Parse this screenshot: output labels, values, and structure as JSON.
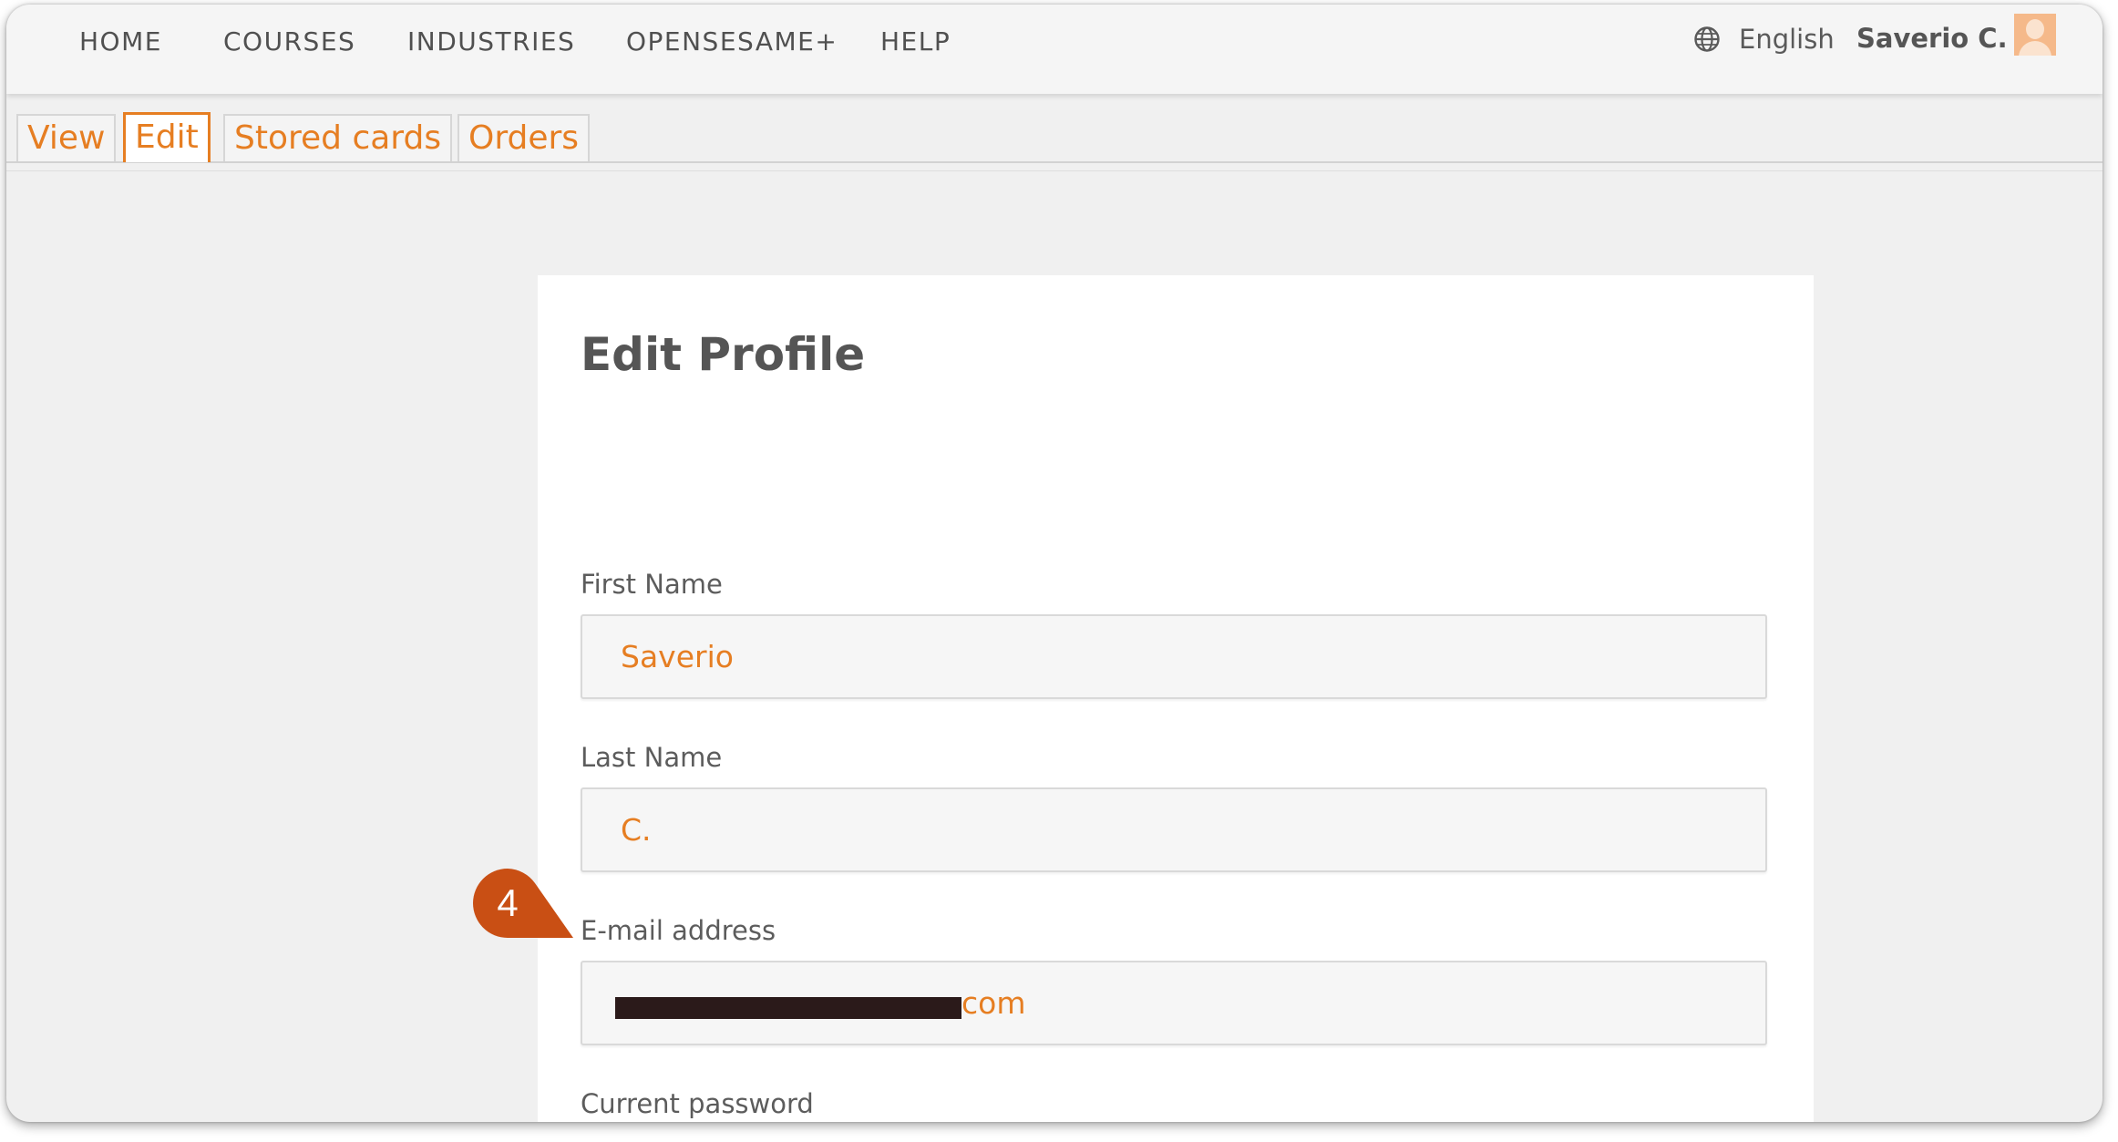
{
  "nav": {
    "items": [
      {
        "id": "home",
        "label": "HOME"
      },
      {
        "id": "courses",
        "label": "COURSES"
      },
      {
        "id": "industries",
        "label": "INDUSTRIES"
      },
      {
        "id": "opensesame-plus",
        "label": "OPENSESAME+"
      },
      {
        "id": "help",
        "label": "HELP"
      }
    ],
    "language": "English",
    "language_icon": "globe-icon",
    "user_name": "Saverio C.",
    "avatar_icon": "user-avatar"
  },
  "tabs": [
    {
      "label": "View",
      "active": false
    },
    {
      "label": "Edit",
      "active": true
    },
    {
      "label": "Stored cards",
      "active": false
    },
    {
      "label": "Orders",
      "active": false
    }
  ],
  "form": {
    "title": "Edit Profile",
    "first_name": {
      "label": "First Name",
      "value": "Saverio"
    },
    "last_name": {
      "label": "Last Name",
      "value": "C."
    },
    "email": {
      "label": "E-mail address",
      "visible_value": "com",
      "redacted": true
    },
    "current_password": {
      "label": "Current password"
    }
  },
  "callout": {
    "number": "4",
    "color": "#c94f14"
  },
  "colors": {
    "accent": "#e67e22",
    "nav_text": "#505050",
    "page_bg": "#f0f0f0"
  }
}
